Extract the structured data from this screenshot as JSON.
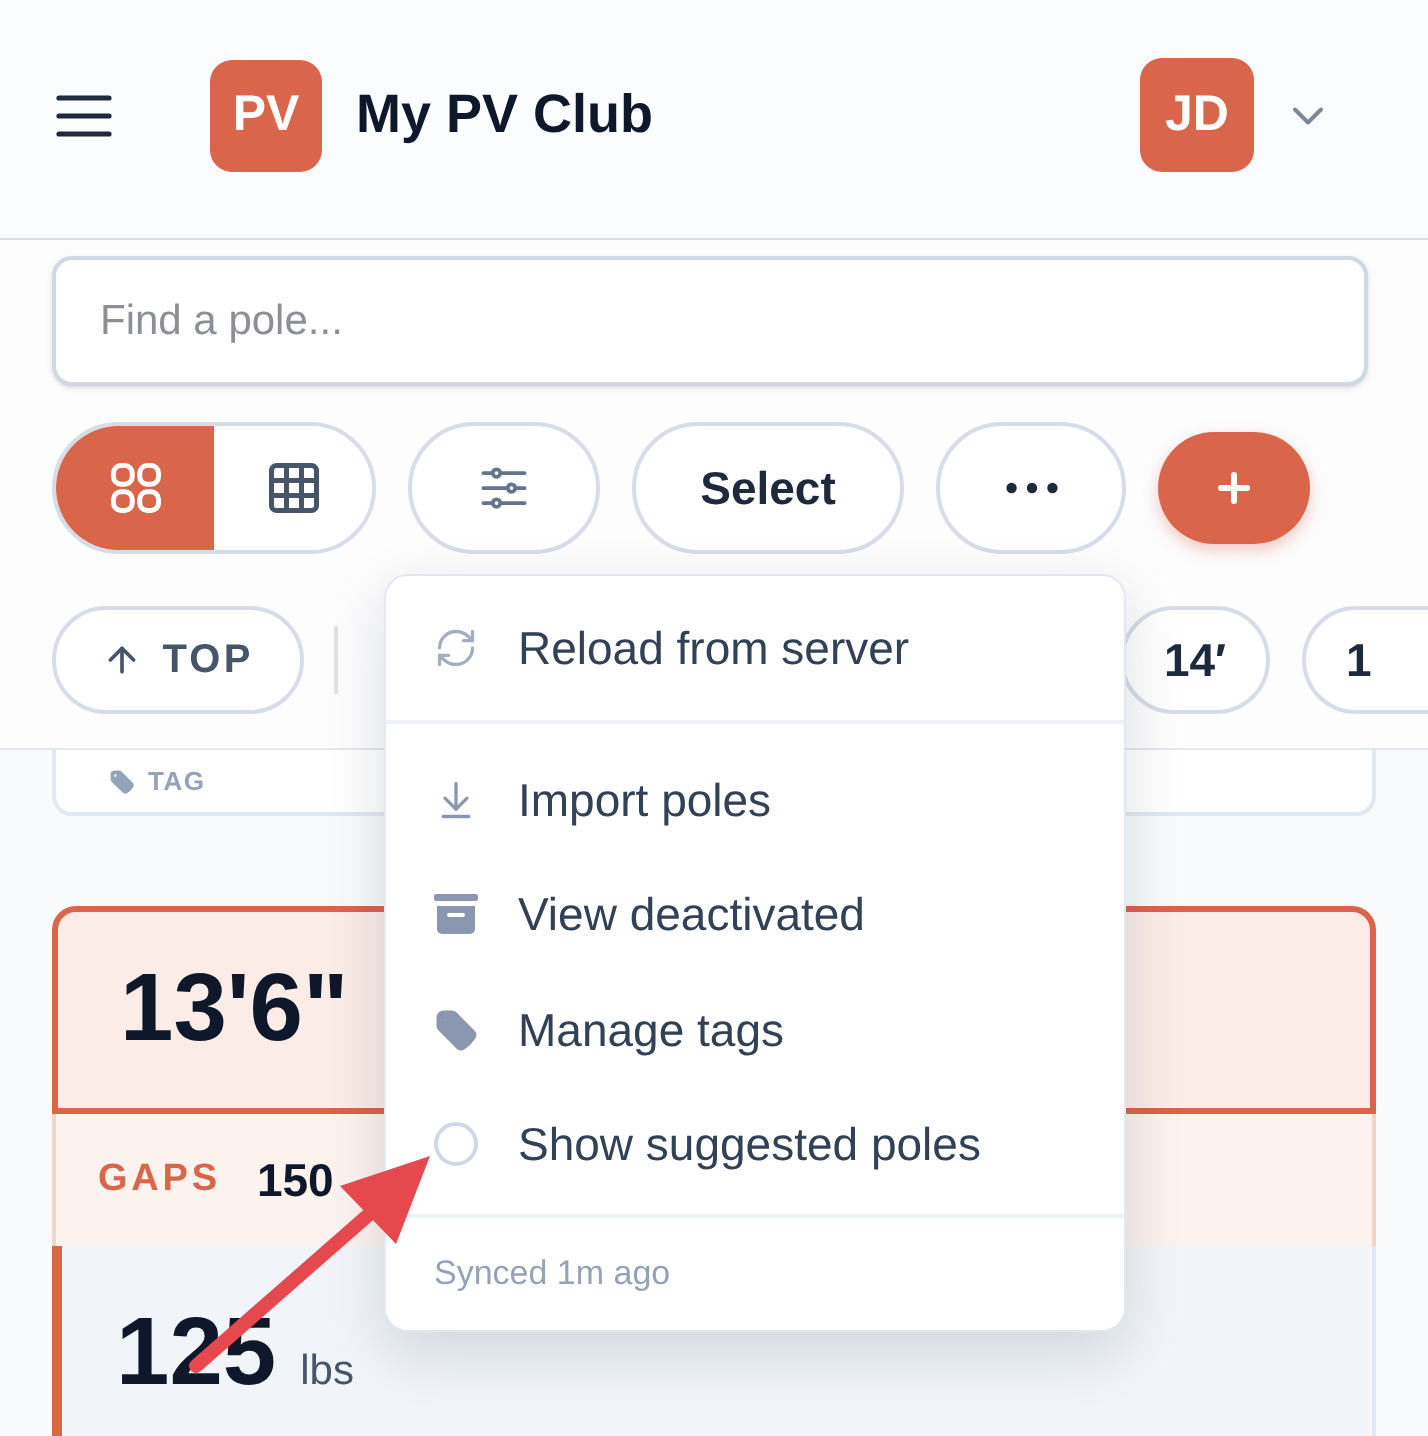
{
  "header": {
    "logo": "PV",
    "title": "My PV Club",
    "avatar": "JD"
  },
  "search": {
    "placeholder": "Find a pole..."
  },
  "toolbar": {
    "view_toggle": [
      {
        "selected": true
      },
      {
        "selected": false
      }
    ],
    "select_label": "Select"
  },
  "chips": [
    {
      "kind": "top",
      "label": "TOP"
    },
    {
      "kind": "height",
      "label": "14′"
    },
    {
      "kind": "height",
      "label": "1"
    }
  ],
  "tag_card": {
    "label": "TAG"
  },
  "pole_card": {
    "height": "13'6\"",
    "gaps_label": "GAPS",
    "gaps_value": "150",
    "weight": "125",
    "weight_unit": "lbs"
  },
  "menu": {
    "groups": [
      {
        "items": [
          {
            "kind": "action",
            "label": "Reload from server"
          }
        ]
      },
      {
        "items": [
          {
            "kind": "action",
            "label": "Import poles"
          },
          {
            "kind": "action",
            "label": "View deactivated"
          },
          {
            "kind": "action",
            "label": "Manage tags"
          },
          {
            "kind": "toggle",
            "label": "Show suggested poles",
            "checked": false
          }
        ]
      }
    ],
    "footer": "Synced 1m ago"
  }
}
